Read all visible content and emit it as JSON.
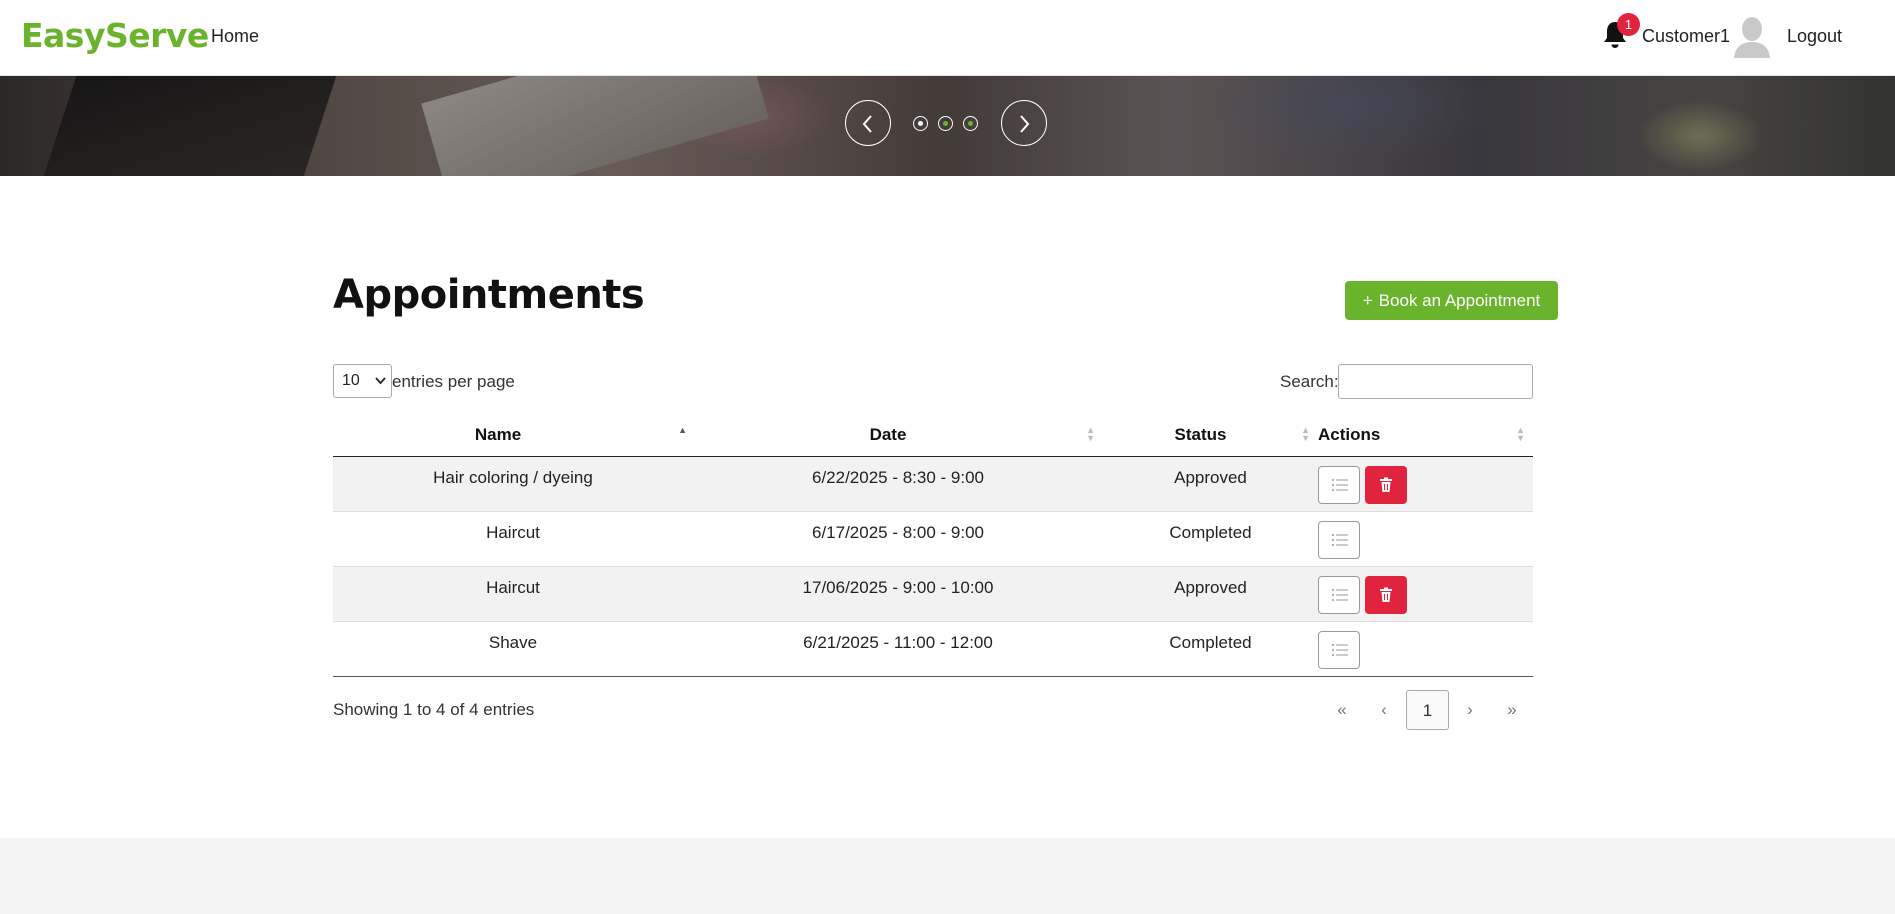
{
  "brand": "EasyServe",
  "nav": {
    "home": "Home",
    "notification_count": "1",
    "user": "Customer1",
    "logout": "Logout"
  },
  "carousel": {
    "slide_count": 3,
    "active_slide": 3
  },
  "page": {
    "title": "Appointments",
    "book_button": "Book an Appointment"
  },
  "table_controls": {
    "page_length": "10",
    "length_label": "entries per page",
    "search_label": "Search:",
    "search_value": ""
  },
  "columns": [
    "Name",
    "Date",
    "Status",
    "Actions"
  ],
  "rows": [
    {
      "name": "Hair coloring / dyeing",
      "date": "6/22/2025 - 8:30 - 9:00",
      "status": "Approved"
    },
    {
      "name": "Haircut",
      "date": "6/17/2025 - 8:00 - 9:00",
      "status": "Completed"
    },
    {
      "name": "Haircut",
      "date": "17/06/2025 - 9:00 - 10:00",
      "status": "Approved"
    },
    {
      "name": "Shave",
      "date": "6/21/2025 - 11:00 - 12:00",
      "status": "Completed"
    }
  ],
  "footer_info": "Showing 1 to 4 of 4 entries",
  "pagination": {
    "first": "«",
    "prev": "‹",
    "current": "1",
    "next": "›",
    "last": "»"
  },
  "colors": {
    "brand_green": "#6ab42d",
    "danger_red": "#e0243e"
  }
}
